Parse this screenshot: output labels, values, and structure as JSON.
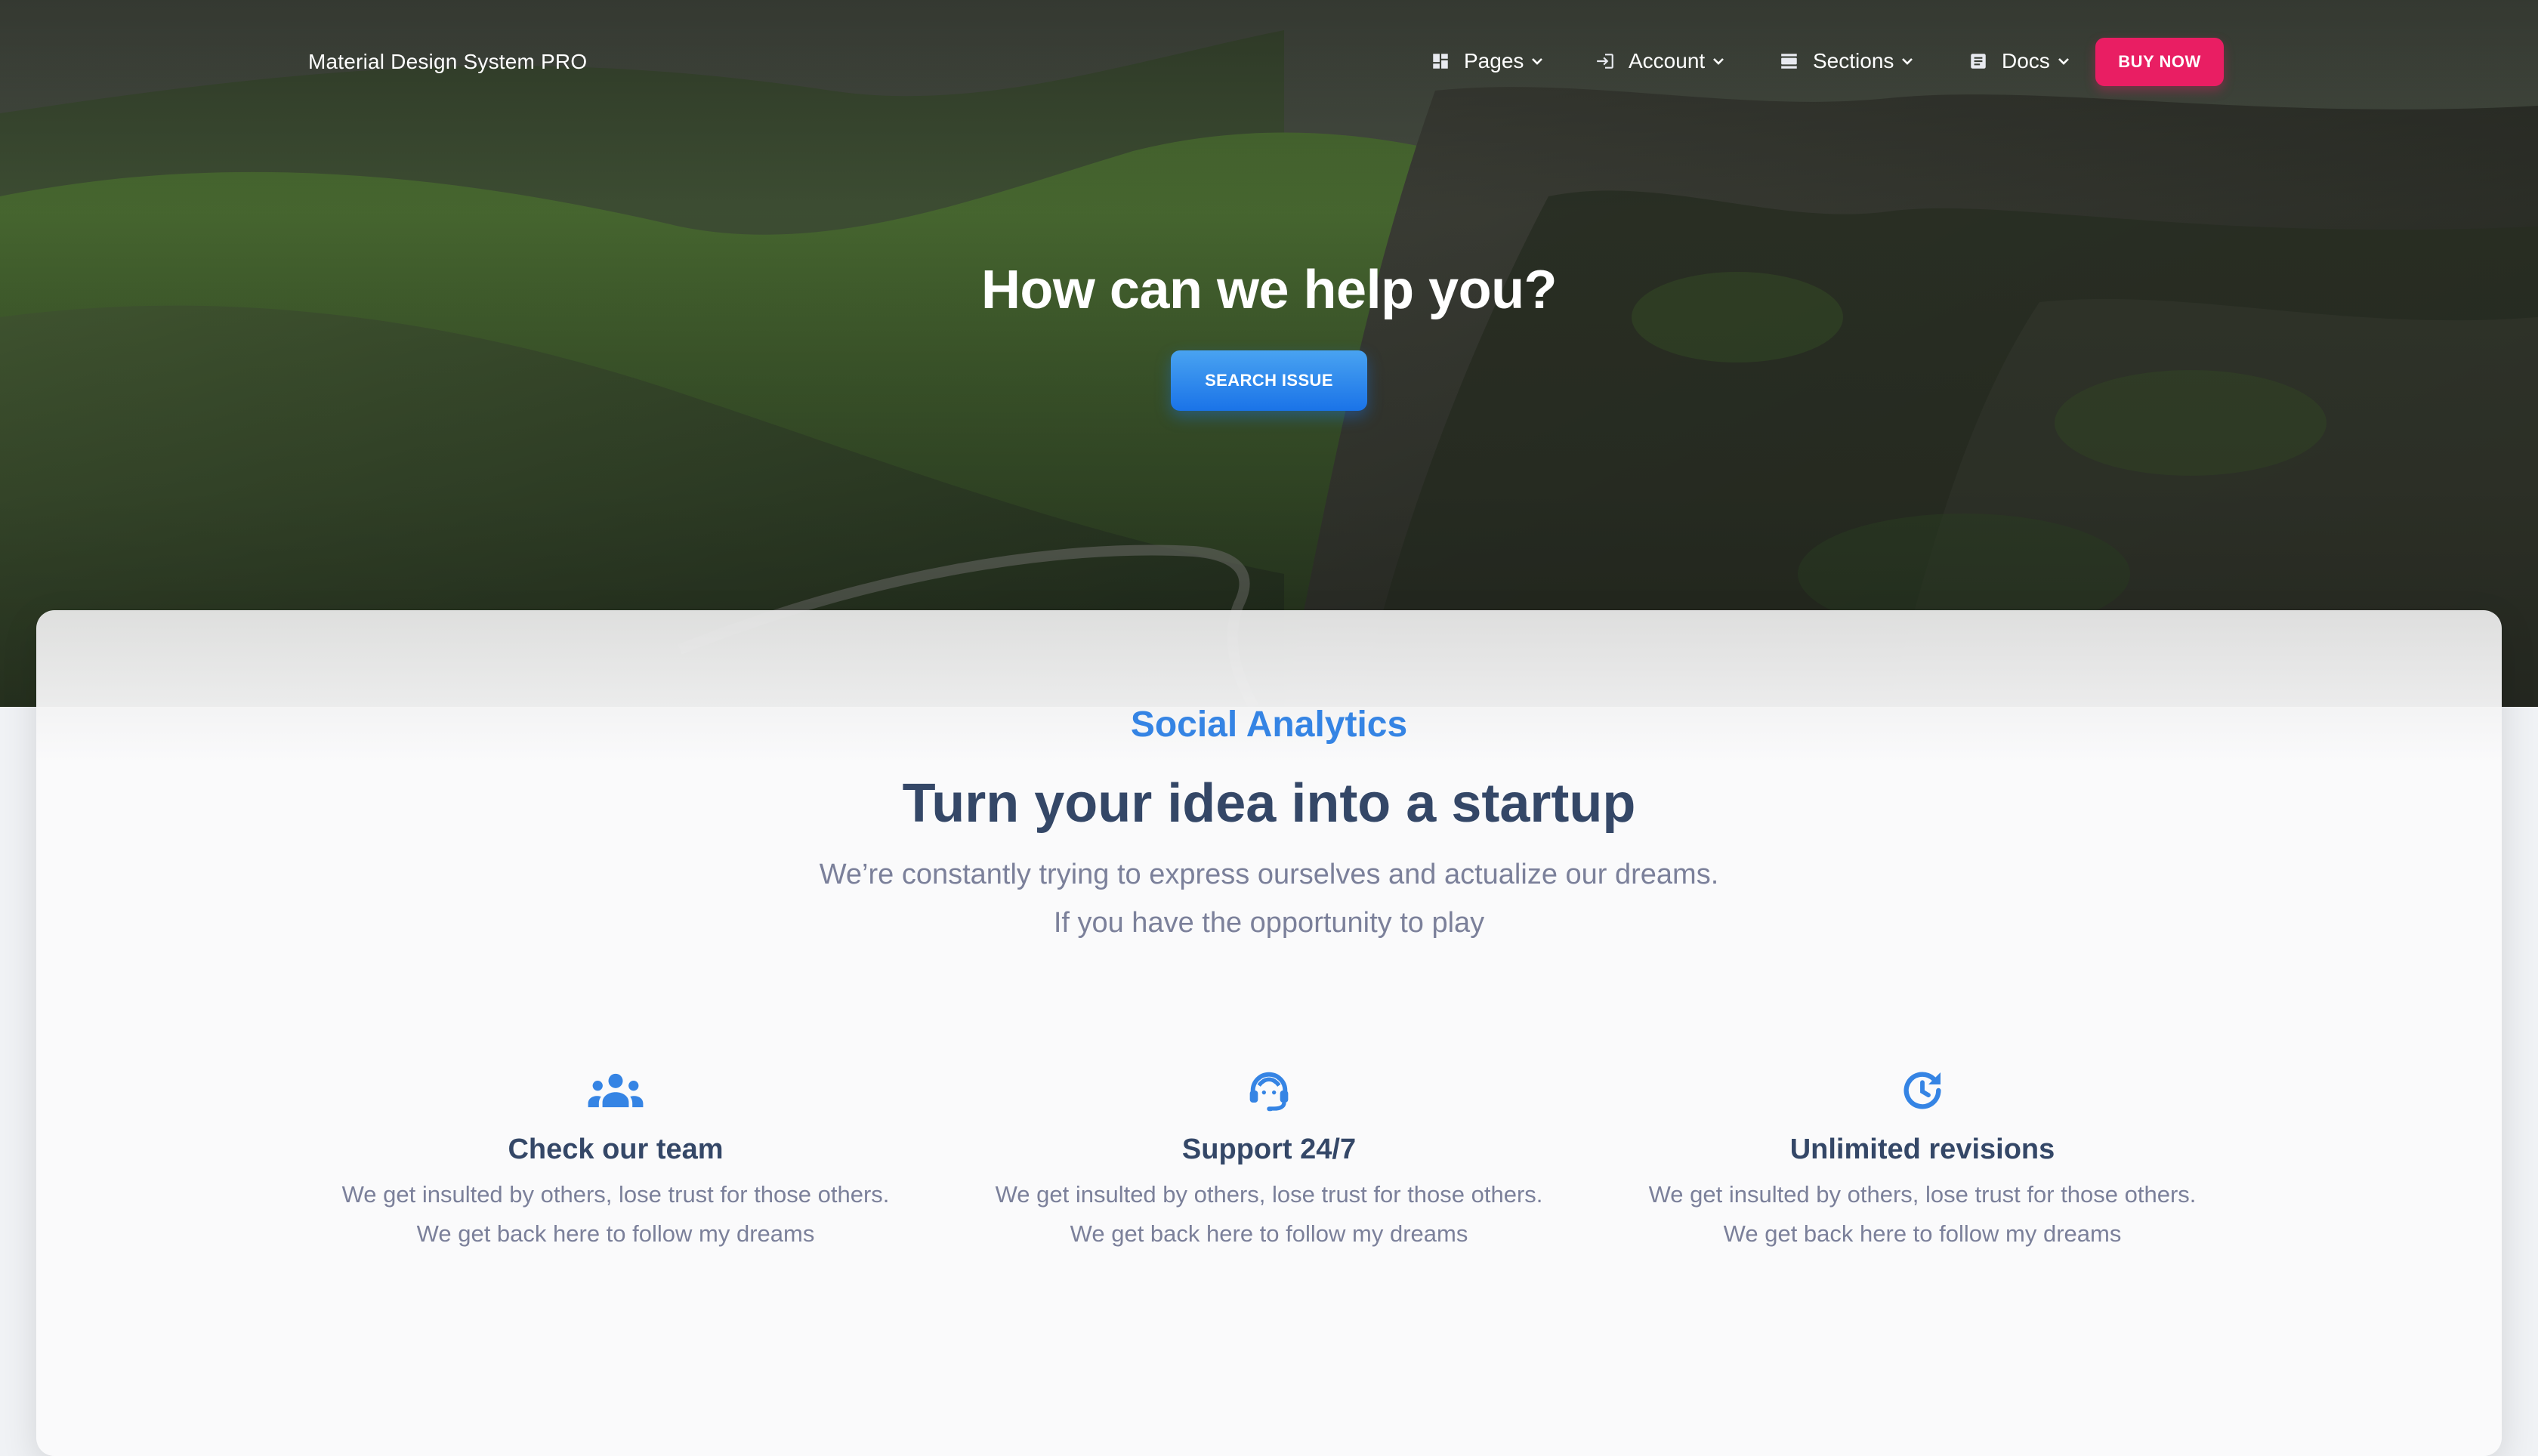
{
  "navbar": {
    "brand": "Material Design System PRO",
    "items": [
      {
        "label": "Pages",
        "icon": "dashboard-icon"
      },
      {
        "label": "Account",
        "icon": "login-icon"
      },
      {
        "label": "Sections",
        "icon": "view-day-icon"
      },
      {
        "label": "Docs",
        "icon": "article-icon"
      }
    ],
    "buy_label": "BUY NOW"
  },
  "hero": {
    "title": "How can we help you?",
    "search_label": "SEARCH ISSUE"
  },
  "section": {
    "eyebrow": "Social Analytics",
    "title": "Turn your idea into a startup",
    "subtitle_line1": "We’re constantly trying to express ourselves and actualize our dreams.",
    "subtitle_line2": "If you have the opportunity to play"
  },
  "features": [
    {
      "icon": "groups-icon",
      "title": "Check our team",
      "line1": "We get insulted by others, lose trust for those others.",
      "line2": "We get back here to follow my dreams"
    },
    {
      "icon": "support-agent-icon",
      "title": "Support 24/7",
      "line1": "We get insulted by others, lose trust for those others.",
      "line2": "We get back here to follow my dreams"
    },
    {
      "icon": "update-icon",
      "title": "Unlimited revisions",
      "line1": "We get insulted by others, lose trust for those others.",
      "line2": "We get back here to follow my dreams"
    }
  ],
  "colors": {
    "brand_pink": "#e91e63",
    "info_blue": "#1a73e8",
    "eyebrow_blue": "#3584e4",
    "heading": "#344767",
    "body_text": "#7b809a"
  }
}
